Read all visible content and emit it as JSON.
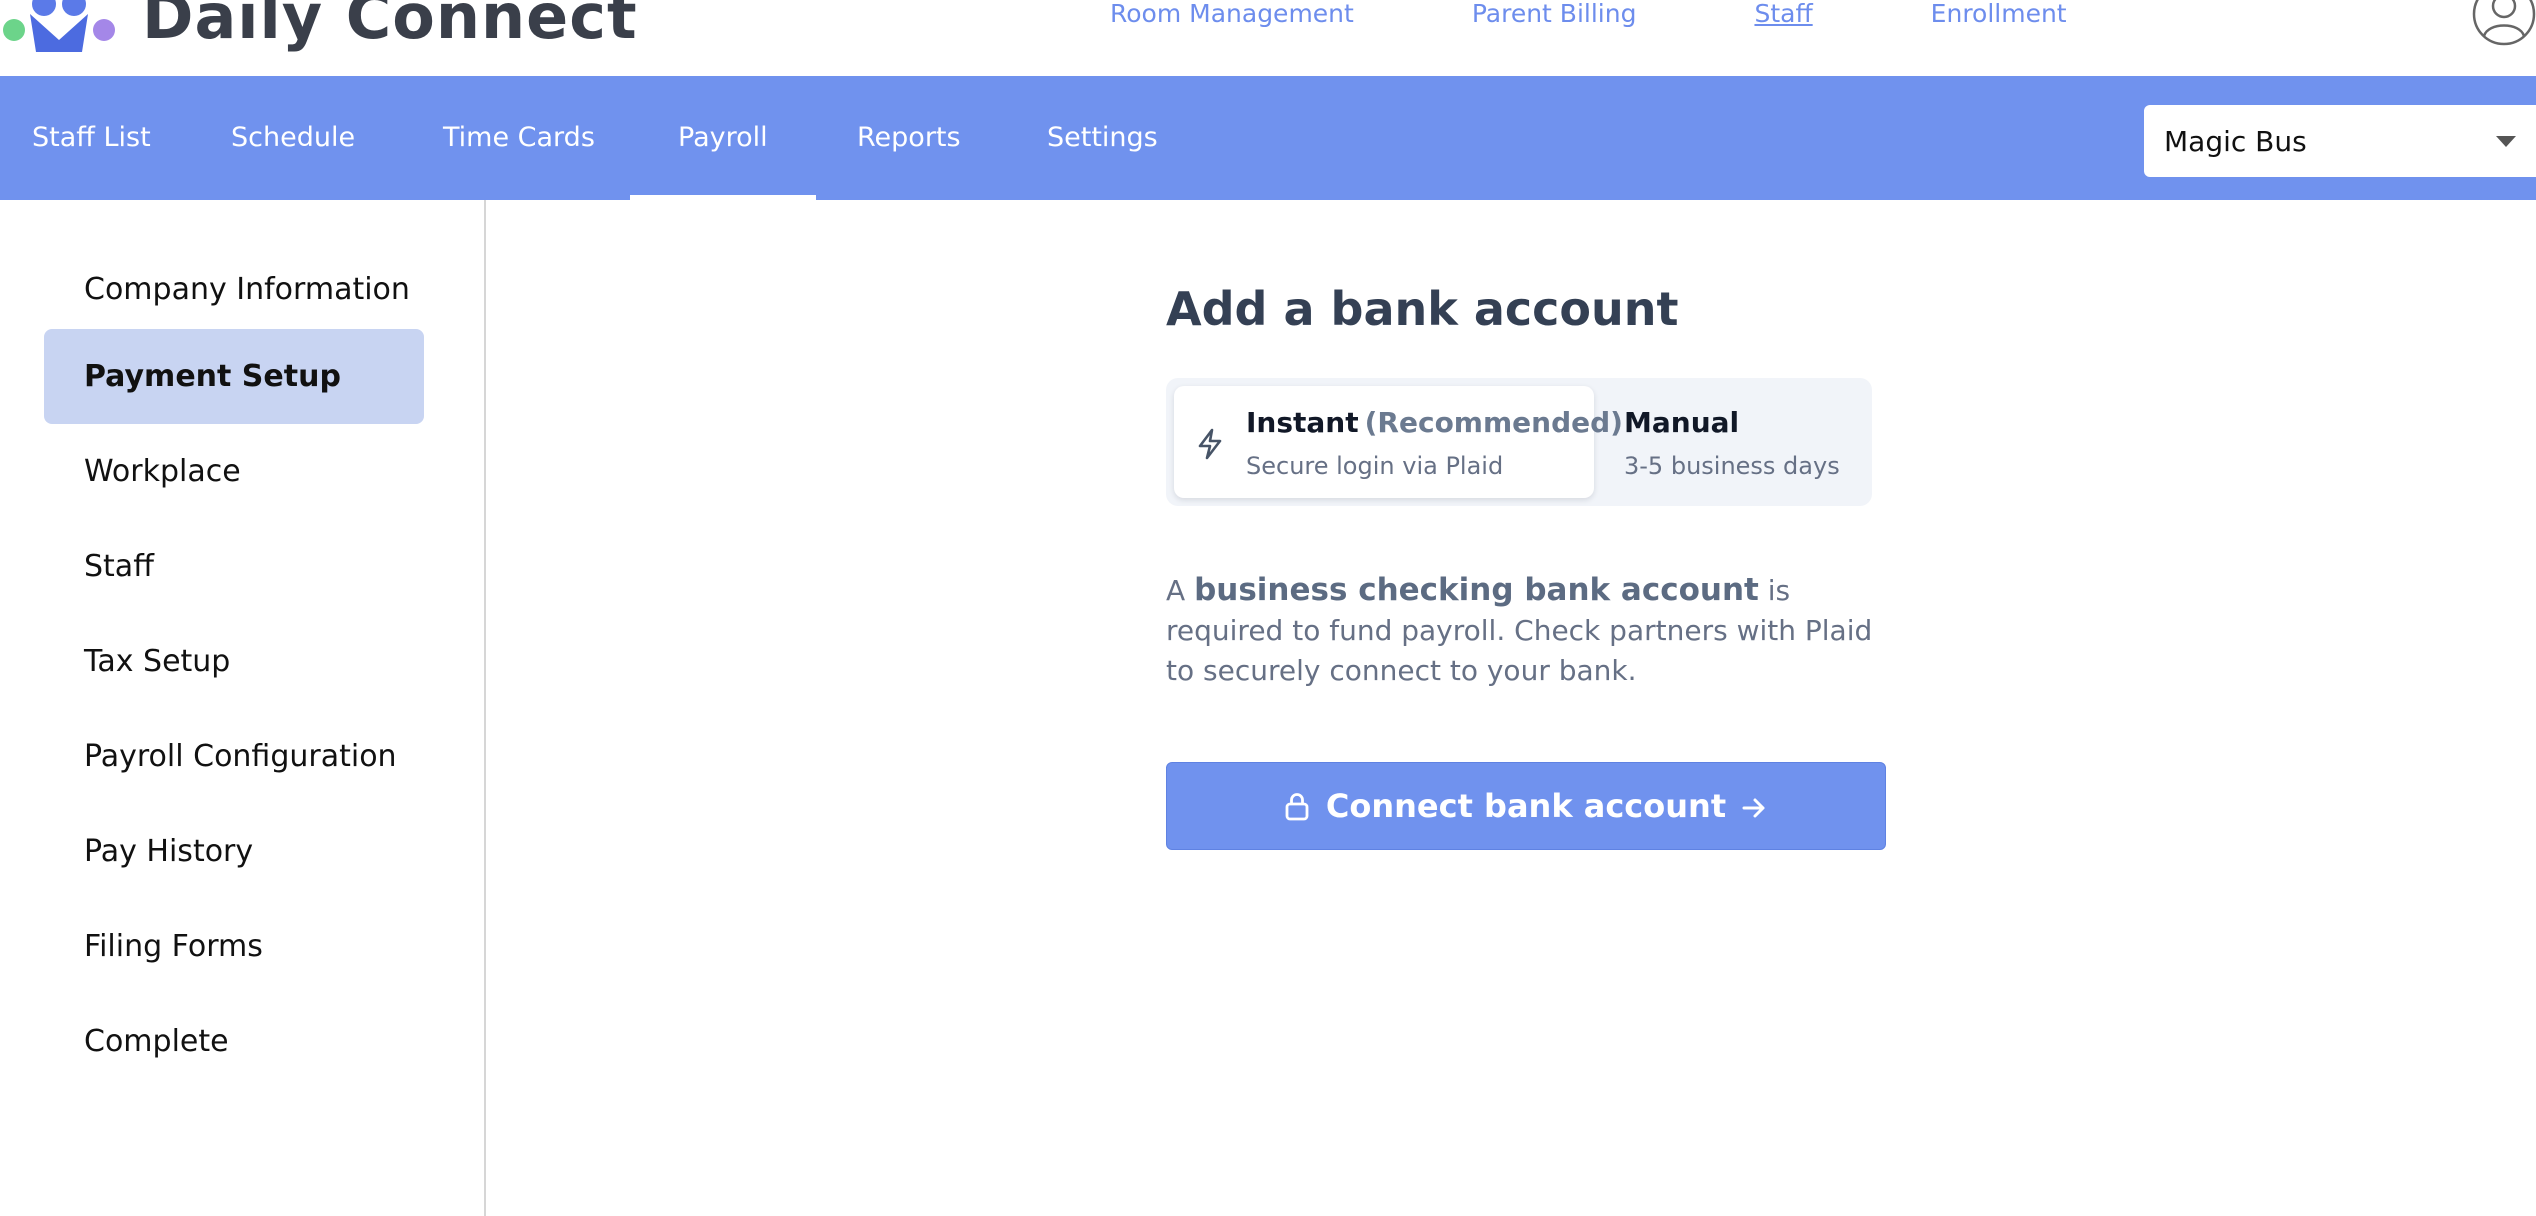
{
  "header": {
    "brand": "Daily Connect",
    "nav": [
      {
        "label": "Room Management"
      },
      {
        "label": "Parent Billing"
      },
      {
        "label": "Staff"
      },
      {
        "label": "Enrollment"
      }
    ],
    "active_nav": "Staff",
    "avatar_icon": "user-circle-icon"
  },
  "subnav": {
    "tabs": [
      {
        "label": "Staff List"
      },
      {
        "label": "Schedule"
      },
      {
        "label": "Time Cards"
      },
      {
        "label": "Payroll"
      },
      {
        "label": "Reports"
      },
      {
        "label": "Settings"
      }
    ],
    "active_tab": "Payroll",
    "location_select": {
      "value": "Magic Bus"
    }
  },
  "sidebar": {
    "items": [
      {
        "label": "Company Information"
      },
      {
        "label": "Payment Setup"
      },
      {
        "label": "Workplace"
      },
      {
        "label": "Staff"
      },
      {
        "label": "Tax Setup"
      },
      {
        "label": "Payroll Configuration"
      },
      {
        "label": "Pay History"
      },
      {
        "label": "Filing Forms"
      },
      {
        "label": "Complete"
      }
    ],
    "active_item": "Payment Setup"
  },
  "main": {
    "title": "Add a bank account",
    "methods": {
      "instant": {
        "label": "Instant",
        "tag": "(Recommended)",
        "sub": "Secure login via Plaid",
        "icon": "bolt-icon"
      },
      "manual": {
        "label": "Manual",
        "sub": "3-5 business days"
      }
    },
    "description": {
      "prefix": "A ",
      "bold": "business checking bank account",
      "suffix": " is required to fund payroll. Check partners with Plaid to securely connect to your bank."
    },
    "connect_button": {
      "label": "Connect bank account",
      "icon_left": "lock-icon",
      "icon_right": "arrow-right-icon"
    }
  },
  "colors": {
    "accent": "#7092ee",
    "nav_link": "#6d8ded",
    "active_side": "#c8d4f2",
    "title": "#344054"
  }
}
